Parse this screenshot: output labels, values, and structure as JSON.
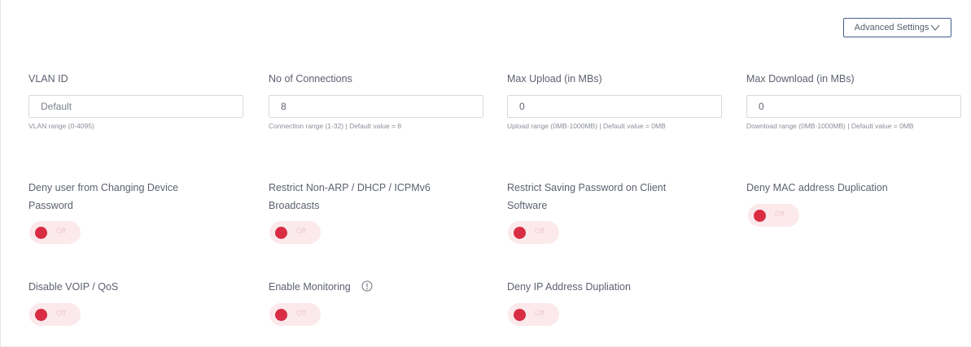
{
  "advanced_settings": {
    "label": "Advanced Settings"
  },
  "fields": [
    {
      "label": "VLAN ID",
      "value": "",
      "placeholder": "Default",
      "helper": "VLAN range (0-4095)"
    },
    {
      "label": "No of Connections",
      "value": "8",
      "placeholder": "",
      "helper": "Connection range (1-32) | Default value = 8"
    },
    {
      "label": "Max Upload (in MBs)",
      "value": "0",
      "placeholder": "",
      "helper": "Upload range (0MB-1000MB) | Default value = 0MB"
    },
    {
      "label": "Max Download (in MBs)",
      "value": "0",
      "placeholder": "",
      "helper": "Download range (0MB-1000MB) | Default value = 0MB"
    }
  ],
  "toggles": [
    {
      "label": "Deny user from Changing Device Password",
      "state": "off",
      "state_text": "Off"
    },
    {
      "label": "Restrict Non-ARP / DHCP / ICPMv6 Broadcasts",
      "state": "off",
      "state_text": "Off"
    },
    {
      "label": "Restrict Saving Password on Client Software",
      "state": "off",
      "state_text": "Off"
    },
    {
      "label": "Deny MAC address Duplication",
      "state": "off",
      "state_text": "Off"
    },
    {
      "label": "Disable VOIP / QoS",
      "state": "off",
      "state_text": "Off"
    },
    {
      "label": "Enable Monitoring",
      "state": "off",
      "state_text": "Off",
      "icon": "info-icon"
    },
    {
      "label": "Deny IP Address Dupliation",
      "state": "off",
      "state_text": "Off"
    }
  ],
  "colors": {
    "toggle_off_track": "#fbe9eb",
    "toggle_knob": "#d92d44",
    "button_border": "#46618a"
  }
}
